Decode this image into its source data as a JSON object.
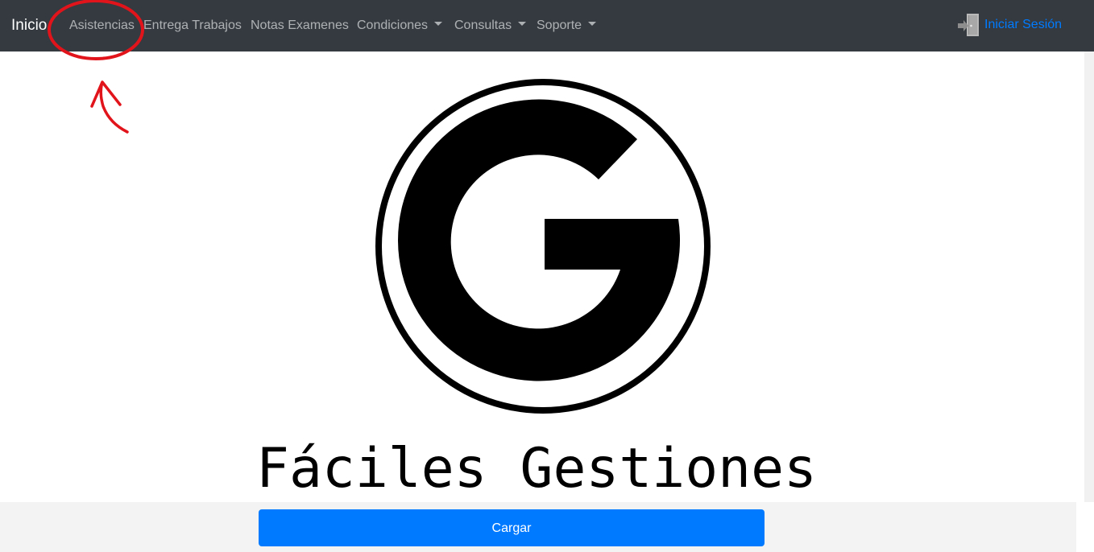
{
  "navbar": {
    "brand": "Inicio",
    "items": [
      {
        "label": "Asistencias",
        "dropdown": false
      },
      {
        "label": "Entrega Trabajos",
        "dropdown": false
      },
      {
        "label": "Notas Examenes",
        "dropdown": false
      },
      {
        "label": "Condiciones",
        "dropdown": true
      },
      {
        "label": "Consultas",
        "dropdown": true
      },
      {
        "label": "Soporte",
        "dropdown": true
      }
    ],
    "login_label": "Iniciar Sesión",
    "login_icon": "sign-in-door-icon"
  },
  "main": {
    "logo_icon": "g-circle-logo",
    "title": "Fáciles Gestiones"
  },
  "footer": {
    "button_label": "Cargar"
  },
  "colors": {
    "navbar_bg": "#343a40",
    "accent": "#007bff",
    "annotation": "#e2141b"
  }
}
